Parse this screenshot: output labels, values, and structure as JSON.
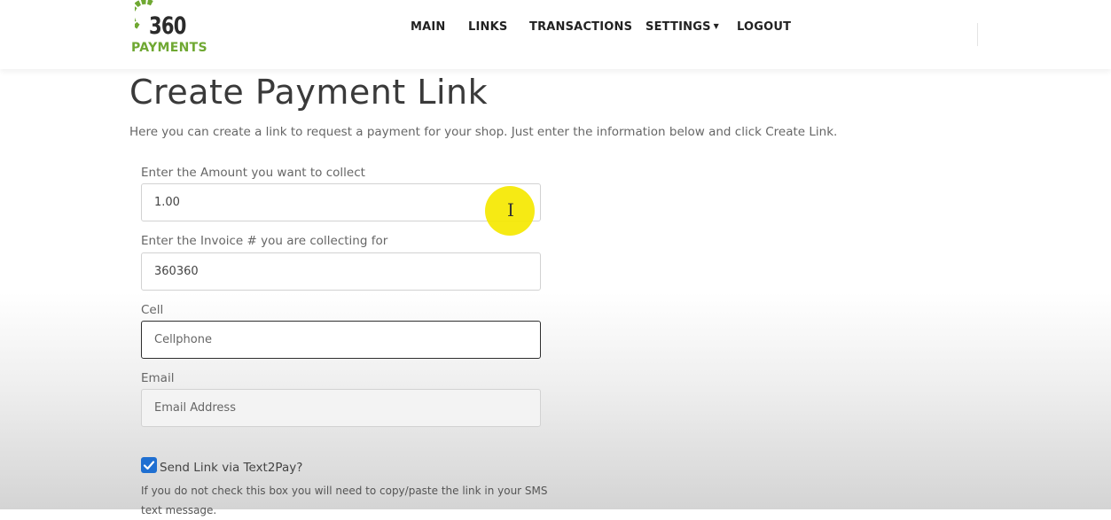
{
  "brand": {
    "number": "360",
    "name": "PAYMENTS",
    "green": "#6fa832"
  },
  "nav": {
    "main": "MAIN",
    "links": "LINKS",
    "transactions": "TRANSACTIONS",
    "settings": "SETTINGS",
    "logout": "LOGOUT"
  },
  "page": {
    "title": "Create Payment Link",
    "intro": "Here you can create a link to request a payment for your shop.  Just enter the information below and click Create Link."
  },
  "form": {
    "amount": {
      "label": "Enter the Amount you want to collect",
      "value": "1.00"
    },
    "invoice": {
      "label": "Enter the Invoice # you are collecting for",
      "value": "360360"
    },
    "cell": {
      "label": "Cell",
      "placeholder": "Cellphone",
      "value": ""
    },
    "email": {
      "label": "Email",
      "placeholder": "Email Address",
      "value": ""
    },
    "text2pay": {
      "label": "Send Link via Text2Pay?",
      "checked": true,
      "hint": "If you do not check this box you will need to copy/paste the link in your SMS text message."
    }
  },
  "colors": {
    "checkbox": "#1f6fd1",
    "cursor_highlight": "#f5e800"
  }
}
